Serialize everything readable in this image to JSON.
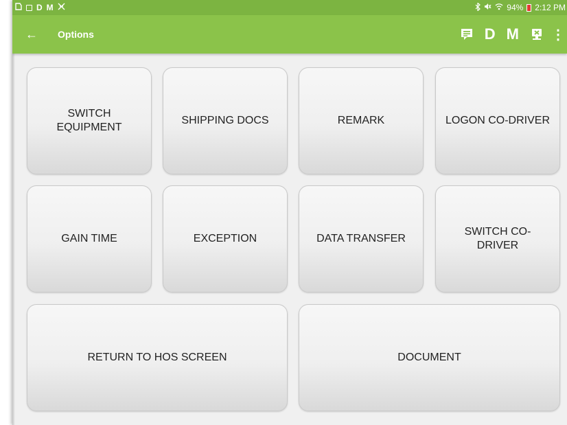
{
  "status_bar": {
    "left_letters": [
      "D",
      "M"
    ],
    "battery": "94%",
    "time": "2:12 PM"
  },
  "app_bar": {
    "back_icon": "arrow-left-icon",
    "title": "Options",
    "actions": {
      "message_icon": "message-icon",
      "d_label": "D",
      "m_label": "M",
      "device_icon": "device-icon",
      "overflow_icon": "more-vert-icon"
    }
  },
  "options": [
    {
      "label": "SWITCH EQUIPMENT"
    },
    {
      "label": "SHIPPING DOCS"
    },
    {
      "label": "REMARK"
    },
    {
      "label": "LOGON CO-DRIVER"
    },
    {
      "label": "GAIN TIME"
    },
    {
      "label": "EXCEPTION"
    },
    {
      "label": "DATA TRANSFER"
    },
    {
      "label": "SWITCH CO-DRIVER"
    },
    {
      "label": "RETURN TO HOS SCREEN"
    },
    {
      "label": "DOCUMENT"
    }
  ],
  "colors": {
    "status_bar": "#7cb441",
    "app_bar": "#8bc34a",
    "background": "#f0f0f0"
  }
}
